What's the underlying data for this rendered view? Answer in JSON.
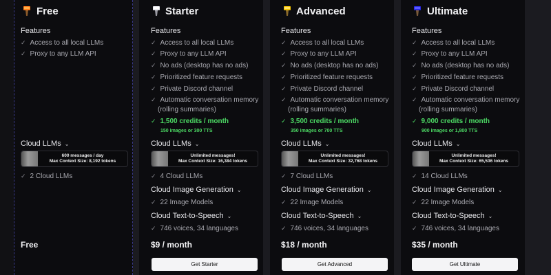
{
  "plans": {
    "free": {
      "title": "Free",
      "features_heading": "Features",
      "features": [
        "Access to all local LLMs",
        "Proxy to any LLM API"
      ],
      "cloud_llms_heading": "Cloud LLMs",
      "cloud_llms_info": [
        "600 messages / day",
        "Max Context Size: 8,192 tokens"
      ],
      "cloud_llms_count": "2 Cloud LLMs",
      "price": "Free"
    },
    "starter": {
      "title": "Starter",
      "features_heading": "Features",
      "features": [
        "Access to all local LLMs",
        "Proxy to any LLM API",
        "No ads (desktop has no ads)",
        "Prioritized feature requests",
        "Private Discord channel",
        "Automatic conversation memory",
        "(rolling summaries)"
      ],
      "credits": "1,500 credits / month",
      "credits_detail": "150 images or 300 TTS",
      "cloud_llms_heading": "Cloud LLMs",
      "cloud_llms_info": [
        "Unlimited messages!",
        "Max Context Size: 16,384 tokens"
      ],
      "cloud_llms_count": "4 Cloud LLMs",
      "image_gen_heading": "Cloud Image Generation",
      "image_models": "22 Image Models",
      "tts_heading": "Cloud Text-to-Speech",
      "tts_detail": "746 voices, 34 languages",
      "price": "$9 / month",
      "button": "Get Starter"
    },
    "advanced": {
      "title": "Advanced",
      "features_heading": "Features",
      "features": [
        "Access to all local LLMs",
        "Proxy to any LLM API",
        "No ads (desktop has no ads)",
        "Prioritized feature requests",
        "Private Discord channel",
        "Automatic conversation memory",
        "(rolling summaries)"
      ],
      "credits": "3,500 credits / month",
      "credits_detail": "350 images or 700 TTS",
      "cloud_llms_heading": "Cloud LLMs",
      "cloud_llms_info": [
        "Unlimited messages!",
        "Max Context Size: 32,768 tokens"
      ],
      "cloud_llms_count": "7 Cloud LLMs",
      "image_gen_heading": "Cloud Image Generation",
      "image_models": "22 Image Models",
      "tts_heading": "Cloud Text-to-Speech",
      "tts_detail": "746 voices, 34 languages",
      "price": "$18 / month",
      "button": "Get Advanced"
    },
    "ultimate": {
      "title": "Ultimate",
      "features_heading": "Features",
      "features": [
        "Access to all local LLMs",
        "Proxy to any LLM API",
        "No ads (desktop has no ads)",
        "Prioritized feature requests",
        "Private Discord channel",
        "Automatic conversation memory",
        "(rolling summaries)"
      ],
      "credits": "9,000 credits / month",
      "credits_detail": "900 images or 1,800 TTS",
      "cloud_llms_heading": "Cloud LLMs",
      "cloud_llms_info": [
        "Unlimited messages!",
        "Max Context Size: 65,536 tokens"
      ],
      "cloud_llms_count": "14 Cloud LLMs",
      "image_gen_heading": "Cloud Image Generation",
      "image_models": "22 Image Models",
      "tts_heading": "Cloud Text-to-Speech",
      "tts_detail": "746 voices, 34 languages",
      "price": "$35 / month",
      "button": "Get Ultimate"
    }
  },
  "colors": {
    "accent_green": "#4cd964",
    "background": "#111114",
    "card": "#0c0c0f",
    "button": "#f4f4f6"
  },
  "icons": {
    "free": "orange-torch-icon",
    "starter": "white-torch-icon",
    "advanced": "yellow-torch-icon",
    "ultimate": "blue-torch-icon"
  }
}
